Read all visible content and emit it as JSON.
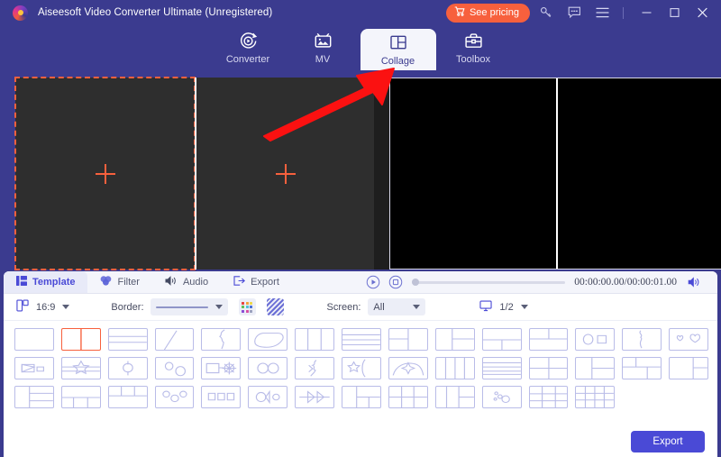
{
  "window": {
    "title": "Aiseesoft Video Converter Ultimate (Unregistered)",
    "logo_icon": "aiseesoft-logo",
    "pricing_label": "See pricing",
    "pricing_icon": "cart-icon",
    "key_icon": "key-icon",
    "feedback_icon": "chat-bubble-icon",
    "menu_icon": "hamburger-menu-icon",
    "minimize_icon": "minimize-icon",
    "maximize_icon": "maximize-icon",
    "close_icon": "close-icon",
    "accent_color": "#f7603d",
    "chrome_color": "#3b3b8f",
    "primary_color": "#4a4ad6"
  },
  "nav": {
    "tabs": [
      {
        "label": "Converter",
        "icon": "converter-icon",
        "active": false
      },
      {
        "label": "MV",
        "icon": "mv-icon",
        "active": false
      },
      {
        "label": "Collage",
        "icon": "collage-icon",
        "active": true
      },
      {
        "label": "Toolbox",
        "icon": "toolbox-icon",
        "active": false
      }
    ]
  },
  "preview": {
    "slot_add_icon": "plus-icon",
    "slots": [
      {
        "name": "slot-1",
        "selected": true,
        "add_icon": "plus-icon"
      },
      {
        "name": "slot-2",
        "selected": false,
        "add_icon": "plus-icon"
      }
    ],
    "output_panes": 2,
    "output_background": "#000000"
  },
  "subtabs": {
    "items": [
      {
        "label": "Template",
        "icon": "template-icon",
        "active": true
      },
      {
        "label": "Filter",
        "icon": "filter-icon",
        "active": false
      },
      {
        "label": "Audio",
        "icon": "audio-icon",
        "active": false
      },
      {
        "label": "Export",
        "icon": "export-icon",
        "active": false
      }
    ],
    "play_icon": "play-icon",
    "stop_icon": "stop-icon",
    "seek_value": 0,
    "timecode": "00:00:00.00/00:00:01.00",
    "volume_icon": "volume-icon"
  },
  "options": {
    "ratio_icon": "aspect-ratio-icon",
    "ratio_value": "16:9",
    "border_label": "Border:",
    "border_style_value": "solid-line",
    "border_color_icon": "color-palette-icon",
    "border_pattern_icon": "stripe-pattern-icon",
    "screen_label": "Screen:",
    "screen_value": "All",
    "page_icon": "monitor-icon",
    "page_value": "1/2"
  },
  "templates": {
    "selected_index": 1,
    "count": 43,
    "items": [
      {
        "name": "template-single",
        "shape": "single"
      },
      {
        "name": "template-2-vertical",
        "shape": "v2"
      },
      {
        "name": "template-2-horizontal",
        "shape": "h2"
      },
      {
        "name": "template-diagonal",
        "shape": "diag"
      },
      {
        "name": "template-arrow-cut",
        "shape": "arrowcut"
      },
      {
        "name": "template-rounded-inset",
        "shape": "rounded"
      },
      {
        "name": "template-3-vertical",
        "shape": "v3"
      },
      {
        "name": "template-3-horizontal",
        "shape": "h3"
      },
      {
        "name": "template-left-2-right-1",
        "shape": "l2r1"
      },
      {
        "name": "template-left-1-right-2",
        "shape": "l1r2"
      },
      {
        "name": "template-top-1-bottom-2",
        "shape": "t1b2"
      },
      {
        "name": "template-top-2-bottom-1",
        "shape": "t2b1"
      },
      {
        "name": "template-circle-square",
        "shape": "circsq"
      },
      {
        "name": "template-lightning-split",
        "shape": "bolt"
      },
      {
        "name": "template-two-hearts",
        "shape": "hearts"
      },
      {
        "name": "template-flag-shape",
        "shape": "flag"
      },
      {
        "name": "template-star-band",
        "shape": "starband"
      },
      {
        "name": "template-balloon",
        "shape": "balloon"
      },
      {
        "name": "template-two-ovals",
        "shape": "ovals2"
      },
      {
        "name": "template-gear-tag",
        "shape": "geartag"
      },
      {
        "name": "template-double-circle",
        "shape": "circ2"
      },
      {
        "name": "template-burst-cut",
        "shape": "burst"
      },
      {
        "name": "template-star-slice",
        "shape": "starslice"
      },
      {
        "name": "template-arch-star",
        "shape": "archstar"
      },
      {
        "name": "template-4-vertical",
        "shape": "v4"
      },
      {
        "name": "template-4-horizontal",
        "shape": "h4"
      },
      {
        "name": "template-2x2-grid",
        "shape": "grid22"
      },
      {
        "name": "template-mixed-a",
        "shape": "mixa"
      },
      {
        "name": "template-mixed-b",
        "shape": "mixb"
      },
      {
        "name": "template-left-stack-right",
        "shape": "lsr"
      },
      {
        "name": "template-left-wide-right-stack",
        "shape": "lwrs"
      },
      {
        "name": "template-top-wide-bottom-3",
        "shape": "twb3"
      },
      {
        "name": "template-top-3-bottom-wide",
        "shape": "t3bw"
      },
      {
        "name": "template-three-circles",
        "shape": "circ3"
      },
      {
        "name": "template-three-squares",
        "shape": "sq3"
      },
      {
        "name": "template-oval-row",
        "shape": "ovalrow"
      },
      {
        "name": "template-chevrons",
        "shape": "chev"
      },
      {
        "name": "template-mixed-c",
        "shape": "mixc"
      },
      {
        "name": "template-mixed-d",
        "shape": "mixd"
      },
      {
        "name": "template-mixed-e",
        "shape": "mixe"
      },
      {
        "name": "template-bubbles",
        "shape": "bubbles"
      },
      {
        "name": "template-2x3-grid",
        "shape": "grid23"
      },
      {
        "name": "template-3x3-grid",
        "shape": "grid33"
      }
    ]
  },
  "footer": {
    "export_label": "Export"
  },
  "annotation": {
    "arrow_color": "#ff1010",
    "points_to": "collage-tab"
  }
}
